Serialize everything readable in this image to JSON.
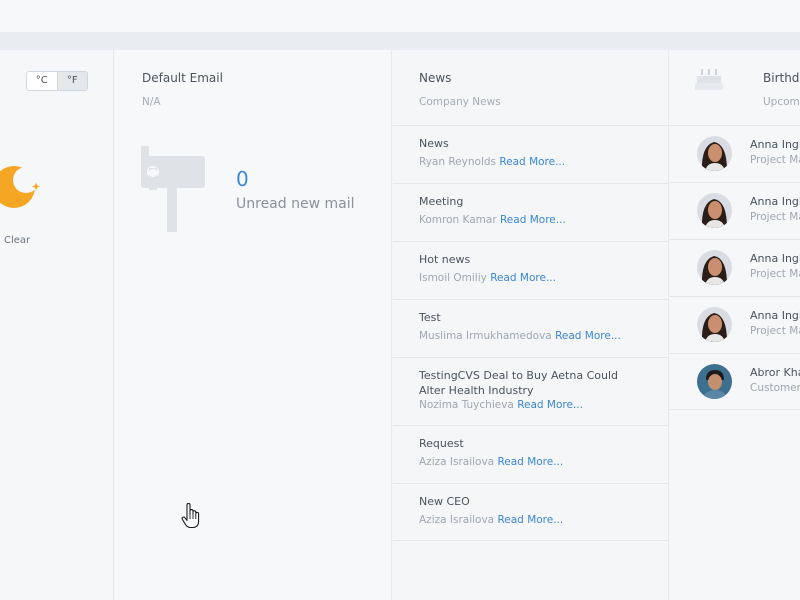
{
  "weather": {
    "unit_c": "°C",
    "unit_f": "°F",
    "condition": "Clear"
  },
  "email": {
    "title": "Default Email",
    "subtitle": "N/A",
    "count": "0",
    "count_label": "Unread new mail"
  },
  "news": {
    "title": "News",
    "subtitle": "Company News",
    "read_more": "Read More...",
    "items": [
      {
        "title": "News",
        "author": "Ryan Reynolds"
      },
      {
        "title": "Meeting",
        "author": "Komron Kamar"
      },
      {
        "title": "Hot news",
        "author": "Ismoil Omiliy"
      },
      {
        "title": "Test",
        "author": "Muslima Irmukhamedova"
      },
      {
        "title": "TestingCVS Deal to Buy Aetna Could Alter Health Industry",
        "author": "Nozima Tuychieva"
      },
      {
        "title": "Request",
        "author": "Aziza Israilova"
      },
      {
        "title": "New CEO",
        "author": "Aziza Israilova"
      }
    ]
  },
  "birthdays": {
    "title": "Birthd",
    "subtitle": "Upcom",
    "items": [
      {
        "name": "Anna Ingl",
        "role": "Project Ma"
      },
      {
        "name": "Anna Ingl",
        "role": "Project Ma"
      },
      {
        "name": "Anna Ingl",
        "role": "Project Ma"
      },
      {
        "name": "Anna Ingl",
        "role": "Project Ma"
      },
      {
        "name": "Abror Kha",
        "role": "Customer"
      }
    ]
  },
  "colors": {
    "accent": "#3a86d3",
    "moon": "#f5a623"
  }
}
